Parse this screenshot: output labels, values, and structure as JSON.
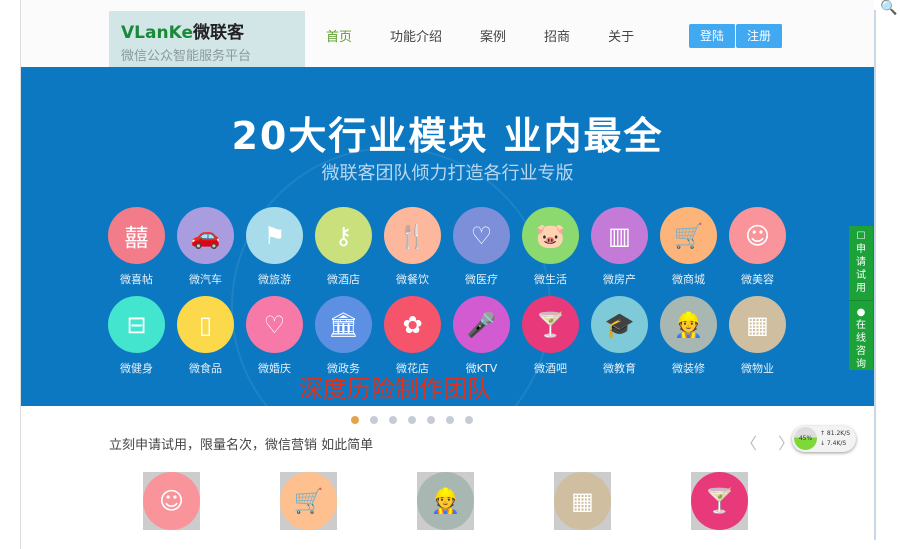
{
  "header": {
    "brand": "VLanKe",
    "brand_cn": "微联客",
    "slogan": "微信公众智能服务平台",
    "nav": [
      "首页",
      "功能介绍",
      "案例",
      "招商",
      "关于"
    ],
    "login": "登陆",
    "register": "注册"
  },
  "banner": {
    "title": "20大行业模块 业内最全",
    "subtitle": "微联客团队倾力打造各行业专版",
    "row1": [
      {
        "label": "微喜帖",
        "color": "#f37c8a",
        "icon": "囍"
      },
      {
        "label": "微汽车",
        "color": "#a99de0",
        "icon": "🚗"
      },
      {
        "label": "微旅游",
        "color": "#a8dcea",
        "icon": "⚑"
      },
      {
        "label": "微酒店",
        "color": "#c9e07d",
        "icon": "⚷"
      },
      {
        "label": "微餐饮",
        "color": "#fdb79c",
        "icon": "🍴"
      },
      {
        "label": "微医疗",
        "color": "#7d8fd8",
        "icon": "♡"
      },
      {
        "label": "微生活",
        "color": "#8cd970",
        "icon": "🐷"
      },
      {
        "label": "微房产",
        "color": "#c47bd8",
        "icon": "▥"
      },
      {
        "label": "微商城",
        "color": "#fdb47a",
        "icon": "🛒"
      },
      {
        "label": "微美容",
        "color": "#f8949a",
        "icon": "☺"
      }
    ],
    "row2": [
      {
        "label": "微健身",
        "color": "#44e5cf",
        "icon": "⊟"
      },
      {
        "label": "微食品",
        "color": "#fcd94b",
        "icon": "▯"
      },
      {
        "label": "微婚庆",
        "color": "#f779a8",
        "icon": "♡"
      },
      {
        "label": "微政务",
        "color": "#5d90e2",
        "icon": "🏛"
      },
      {
        "label": "微花店",
        "color": "#f5546a",
        "icon": "✿"
      },
      {
        "label": "微KTV",
        "color": "#d35bd2",
        "icon": "🎤"
      },
      {
        "label": "微酒吧",
        "color": "#e8397a",
        "icon": "🍸"
      },
      {
        "label": "微教育",
        "color": "#7fcad8",
        "icon": "🎓"
      },
      {
        "label": "微装修",
        "color": "#a9b7b3",
        "icon": "👷"
      },
      {
        "label": "微物业",
        "color": "#cfbfa0",
        "icon": "▦"
      }
    ],
    "overlay": "深度历险制作团队",
    "slides": 7,
    "active_slide": 1
  },
  "promo": {
    "tagline": "立刻申请试用，限量名次，微信营销 如此简单",
    "prev": "〈",
    "next": "〉",
    "items": [
      {
        "color": "#f8949a",
        "icon": "☺"
      },
      {
        "color": "#fdc08e",
        "icon": "🛒"
      },
      {
        "color": "#a9b7b3",
        "icon": "👷"
      },
      {
        "color": "#cfbfa0",
        "icon": "▦"
      },
      {
        "color": "#e8397a",
        "icon": "🍸"
      }
    ]
  },
  "speed": {
    "percent": "45%",
    "up": "↑ 81.2K/S",
    "down": "↓ 7.4K/S"
  },
  "side": {
    "trial": "申请试用",
    "consult": "在线咨询"
  }
}
